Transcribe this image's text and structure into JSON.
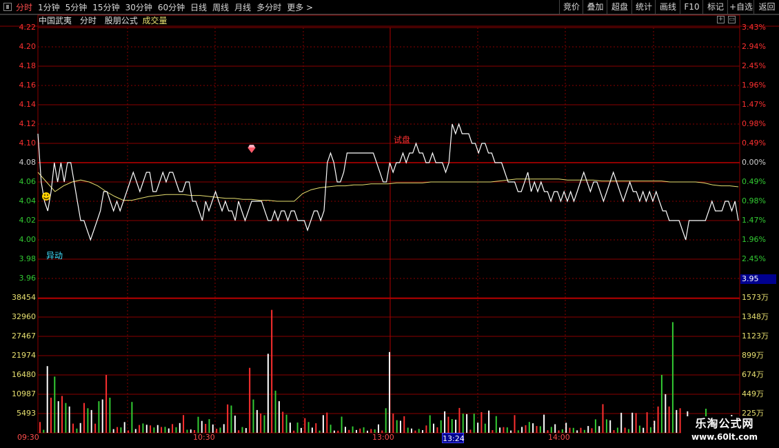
{
  "toolbar": {
    "tabs": [
      "分时",
      "1分钟",
      "5分钟",
      "15分钟",
      "30分钟",
      "60分钟",
      "日线",
      "周线",
      "月线",
      "多分时",
      "更多"
    ],
    "active_tab": "分时",
    "right_buttons": [
      "竞价",
      "叠加",
      "超盘",
      "统计",
      "画线",
      "F10",
      "标记",
      "+自选",
      "返回"
    ]
  },
  "subheader": {
    "stock_name": "中国武夷",
    "mode": "分时",
    "formula": "股朋公式",
    "indicator": "成交量"
  },
  "price_axis": {
    "left_labels": [
      "4.22",
      "4.20",
      "4.18",
      "4.16",
      "4.14",
      "4.12",
      "4.10",
      "4.08",
      "4.06",
      "4.04",
      "4.02",
      "4.00",
      "3.98",
      "3.96"
    ],
    "right_labels": [
      "3.43%",
      "2.94%",
      "2.45%",
      "1.96%",
      "1.47%",
      "0.98%",
      "0.49%",
      "0.00%",
      "0.49%",
      "0.98%",
      "1.47%",
      "1.96%",
      "2.45%"
    ],
    "current_price_label": "3.95"
  },
  "volume_axis": {
    "left_labels": [
      "38454",
      "32960",
      "27467",
      "21974",
      "16480",
      "10987",
      "5493"
    ],
    "right_labels": [
      "1573万",
      "1348万",
      "1123万",
      "899万",
      "674万",
      "449万",
      "225万"
    ]
  },
  "time_axis": {
    "labels": [
      "09:30",
      "10:30",
      "13:00",
      "14:00"
    ],
    "crosshair_time": "13:24"
  },
  "annotations": {
    "anomaly": "异动",
    "signal": "试盘"
  },
  "watermark": {
    "line1": "乐淘公式网",
    "line2": "www.60lt.com"
  },
  "colors": {
    "up": "#ff3030",
    "down": "#33cc33",
    "price_line": "#ffffff",
    "avg_line": "#e8e070",
    "grid": "#8b0000",
    "active": "#ff4d4d",
    "anomaly": "#40e0ff"
  },
  "chart_data": {
    "type": "line",
    "price_ylim": [
      3.96,
      4.22
    ],
    "prev_close": 4.08,
    "price": [
      4.11,
      4.06,
      4.04,
      4.03,
      4.05,
      4.08,
      4.06,
      4.08,
      4.06,
      4.08,
      4.08,
      4.06,
      4.04,
      4.02,
      4.02,
      4.01,
      4.0,
      4.01,
      4.02,
      4.03,
      4.05,
      4.05,
      4.04,
      4.03,
      4.04,
      4.03,
      4.04,
      4.05,
      4.06,
      4.07,
      4.06,
      4.05,
      4.06,
      4.07,
      4.07,
      4.05,
      4.05,
      4.06,
      4.07,
      4.06,
      4.07,
      4.07,
      4.06,
      4.05,
      4.05,
      4.06,
      4.06,
      4.04,
      4.04,
      4.03,
      4.02,
      4.04,
      4.03,
      4.04,
      4.05,
      4.04,
      4.03,
      4.04,
      4.03,
      4.03,
      4.02,
      4.04,
      4.03,
      4.02,
      4.03,
      4.04,
      4.04,
      4.04,
      4.04,
      4.03,
      4.02,
      4.02,
      4.03,
      4.02,
      4.03,
      4.03,
      4.02,
      4.03,
      4.03,
      4.02,
      4.02,
      4.02,
      4.01,
      4.02,
      4.03,
      4.03,
      4.02,
      4.03,
      4.08,
      4.09,
      4.08,
      4.06,
      4.06,
      4.07,
      4.09,
      4.09,
      4.09,
      4.09,
      4.09,
      4.09,
      4.09,
      4.09,
      4.09,
      4.08,
      4.07,
      4.06,
      4.06,
      4.08,
      4.07,
      4.08,
      4.08,
      4.09,
      4.08,
      4.09,
      4.09,
      4.1,
      4.09,
      4.09,
      4.08,
      4.08,
      4.09,
      4.08,
      4.08,
      4.08,
      4.07,
      4.08,
      4.12,
      4.11,
      4.12,
      4.11,
      4.11,
      4.11,
      4.1,
      4.1,
      4.09,
      4.1,
      4.1,
      4.09,
      4.09,
      4.08,
      4.08,
      4.08,
      4.07,
      4.06,
      4.06,
      4.06,
      4.05,
      4.05,
      4.06,
      4.07,
      4.05,
      4.06,
      4.05,
      4.06,
      4.05,
      4.05,
      4.04,
      4.05,
      4.05,
      4.04,
      4.05,
      4.04,
      4.05,
      4.04,
      4.05,
      4.06,
      4.07,
      4.06,
      4.05,
      4.06,
      4.06,
      4.05,
      4.04,
      4.05,
      4.06,
      4.07,
      4.06,
      4.05,
      4.04,
      4.05,
      4.06,
      4.05,
      4.05,
      4.04,
      4.05,
      4.04,
      4.05,
      4.04,
      4.05,
      4.04,
      4.03,
      4.03,
      4.02,
      4.02,
      4.02,
      4.02,
      4.01,
      4.0,
      4.02,
      4.02,
      4.02,
      4.02,
      4.02,
      4.02,
      4.03,
      4.04,
      4.03,
      4.03,
      4.03,
      4.04,
      4.04,
      4.03,
      4.04,
      4.02
    ],
    "avg": [
      4.07,
      4.06,
      4.05,
      4.056,
      4.06,
      4.062,
      4.06,
      4.056,
      4.05,
      4.045,
      4.041,
      4.041,
      4.043,
      4.045,
      4.046,
      4.047,
      4.047,
      4.047,
      4.046,
      4.046,
      4.045,
      4.044,
      4.043,
      4.043,
      4.042,
      4.042,
      4.041,
      4.041,
      4.04,
      4.04,
      4.04,
      4.048,
      4.052,
      4.054,
      4.055,
      4.056,
      4.056,
      4.057,
      4.057,
      4.058,
      4.058,
      4.058,
      4.059,
      4.059,
      4.059,
      4.059,
      4.06,
      4.06,
      4.06,
      4.06,
      4.06,
      4.06,
      4.06,
      4.06,
      4.061,
      4.062,
      4.063,
      4.063,
      4.063,
      4.063,
      4.063,
      4.063,
      4.062,
      4.062,
      4.062,
      4.062,
      4.061,
      4.061,
      4.061,
      4.061,
      4.061,
      4.061,
      4.061,
      4.061,
      4.06,
      4.06,
      4.06,
      4.06,
      4.059,
      4.057,
      4.056,
      4.056,
      4.055
    ],
    "volume_ylim": [
      0,
      38454
    ]
  }
}
